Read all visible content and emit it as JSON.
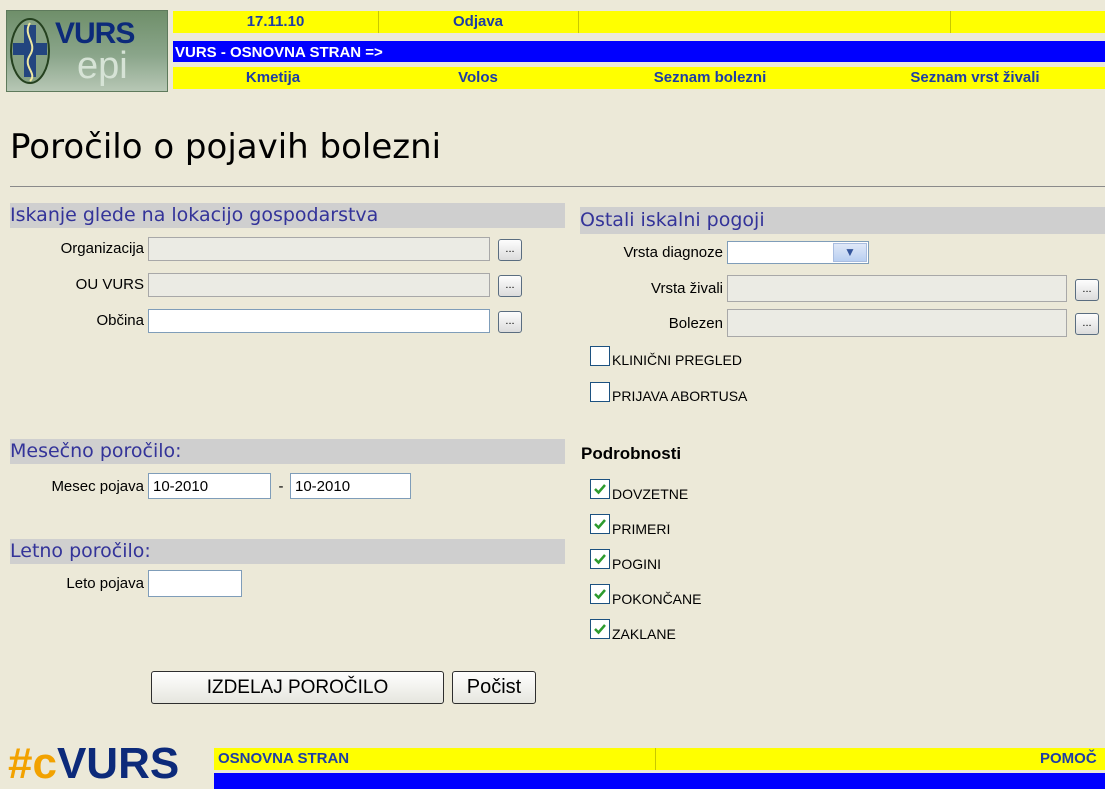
{
  "header": {
    "logo_text": "VURS",
    "logo_sub": "epi",
    "date": "17.11.10",
    "logout": "Odjava",
    "breadcrumb": "VURS - OSNOVNA STRAN  =>",
    "nav": [
      "Kmetija",
      "Volos",
      "Seznam bolezni",
      "Seznam vrst živali"
    ]
  },
  "page": {
    "title": "Poročilo o pojavih bolezni"
  },
  "location": {
    "heading": "Iskanje glede na lokacijo gospodarstva",
    "fields": [
      {
        "label": "Organizacija",
        "value": "",
        "button": "..."
      },
      {
        "label": "OU VURS",
        "value": "",
        "button": "..."
      },
      {
        "label": "Občina",
        "value": "",
        "button": "..."
      }
    ]
  },
  "monthly": {
    "heading": "Mesečno poročilo:",
    "label": "Mesec pojava",
    "from": "10-2010",
    "separator": "-",
    "to": "10-2010"
  },
  "yearly": {
    "heading": "Letno poročilo:",
    "label": "Leto pojava",
    "value": ""
  },
  "other": {
    "heading": "Ostali iskalni pogoji",
    "diagnosis_label": "Vrsta diagnoze",
    "diagnosis_value": "",
    "animal_label": "Vrsta živali",
    "animal_value": "",
    "disease_label": "Bolezen",
    "disease_value": "",
    "button": "...",
    "checks": [
      {
        "label": "KLINIČNI PREGLED",
        "checked": false
      },
      {
        "label": "PRIJAVA ABORTUSA",
        "checked": false
      }
    ]
  },
  "details": {
    "heading": "Podrobnosti",
    "checks": [
      {
        "label": "DOVZETNE",
        "checked": true
      },
      {
        "label": "PRIMERI",
        "checked": true
      },
      {
        "label": "POGINI",
        "checked": true
      },
      {
        "label": "POKONČANE",
        "checked": true
      },
      {
        "label": "ZAKLANE",
        "checked": true
      }
    ]
  },
  "actions": {
    "generate": "IZDELAJ POROČILO",
    "clear": "Počist"
  },
  "footer": {
    "logo_hash": "#c",
    "logo_text": "VURS",
    "home": "OSNOVNA STRAN",
    "help": "POMOČ"
  },
  "colors": {
    "background": "#ECE9D8",
    "header_yellow": "#FFFF00",
    "header_blue": "#0000FF",
    "section_text": "#333399",
    "check_green": "#2e9b2e"
  }
}
